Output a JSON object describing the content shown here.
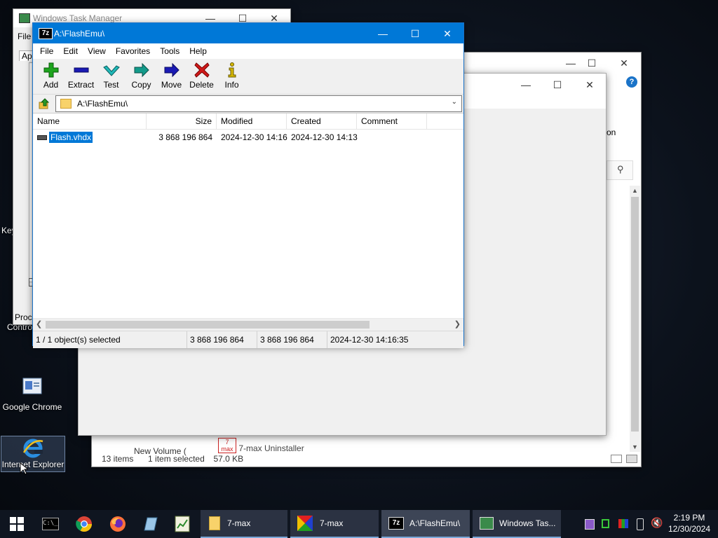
{
  "desktop": {
    "icons": [
      {
        "label": "Control Panel (partial)",
        "text": "Contro"
      },
      {
        "label": "Google Chrome"
      },
      {
        "label": "Internet Explorer"
      }
    ],
    "left_clipped_text": "Key"
  },
  "task_manager": {
    "title": "Windows Task Manager",
    "menu_file": "File",
    "tab_partial": "App",
    "bottom_tab_partial": "Proc"
  },
  "explorer_back": {
    "right_text": "on",
    "items_count": "13 items",
    "selected_info": "1 item selected",
    "size_info": "57.0 KB",
    "list_partial_1": "7-max Uninstaller",
    "list_partial_2": "New Volume (",
    "list_partial_3": "7 max"
  },
  "sevenzip": {
    "title": "A:\\FlashEmu\\",
    "menu": [
      "File",
      "Edit",
      "View",
      "Favorites",
      "Tools",
      "Help"
    ],
    "toolbar": [
      {
        "label": "Add",
        "icon": "plus-icon",
        "color": "#1ea41e"
      },
      {
        "label": "Extract",
        "icon": "minus-icon",
        "color": "#1a1ab4"
      },
      {
        "label": "Test",
        "icon": "check-icon",
        "color": "#1fb8b8"
      },
      {
        "label": "Copy",
        "icon": "copy-arrow-icon",
        "color": "#129a8a"
      },
      {
        "label": "Move",
        "icon": "move-arrow-icon",
        "color": "#1a1ab4"
      },
      {
        "label": "Delete",
        "icon": "delete-x-icon",
        "color": "#d01a1a"
      },
      {
        "label": "Info",
        "icon": "info-icon",
        "color": "#d6b800"
      }
    ],
    "address": "A:\\FlashEmu\\",
    "columns": [
      "Name",
      "Size",
      "Modified",
      "Created",
      "Comment"
    ],
    "rows": [
      {
        "name": "Flash.vhdx",
        "size": "3 868 196 864",
        "modified": "2024-12-30 14:16",
        "created": "2024-12-30 14:13",
        "comment": ""
      }
    ],
    "status": {
      "selection": "1 / 1 object(s) selected",
      "size": "3 868 196 864",
      "packed": "3 868 196 864",
      "date": "2024-12-30 14:16:35"
    }
  },
  "taskbar": {
    "apps": [
      {
        "label": "7-max",
        "icon": "folder-icon"
      },
      {
        "label": "7-max",
        "icon": "7max-icon"
      },
      {
        "label": "A:\\FlashEmu\\",
        "icon": "7zip-icon"
      },
      {
        "label": "Windows Tas...",
        "icon": "taskmgr-icon"
      }
    ],
    "time": "2:19 PM",
    "date": "12/30/2024"
  }
}
